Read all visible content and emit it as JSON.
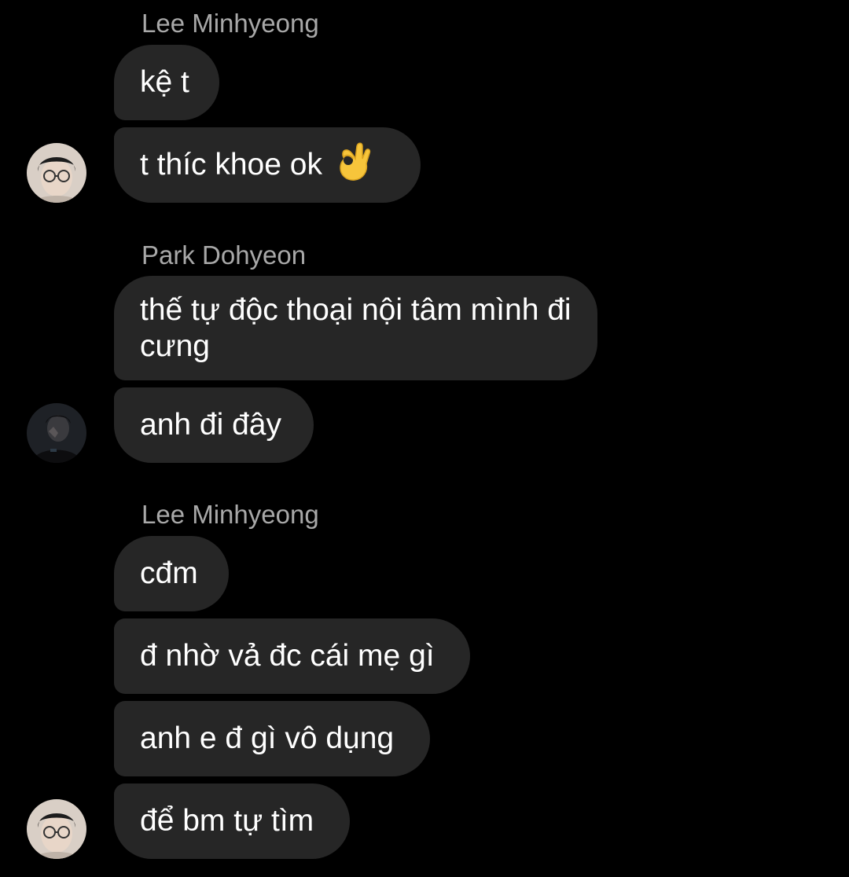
{
  "conversation": {
    "groups": [
      {
        "sender": "Lee Minhyeong",
        "avatar_icon": "profile-avatar-lee-minhyeong",
        "messages": [
          {
            "text": "kệ t"
          },
          {
            "text": "t thíc khoe ok",
            "emoji": "ok-hand-emoji"
          }
        ]
      },
      {
        "sender": "Park Dohyeon",
        "avatar_icon": "profile-avatar-park-dohyeon",
        "messages": [
          {
            "text": "thế tự độc thoại nội tâm mình đi cưng"
          },
          {
            "text": "anh đi đây"
          }
        ]
      },
      {
        "sender": "Lee Minhyeong",
        "avatar_icon": "profile-avatar-lee-minhyeong",
        "messages": [
          {
            "text": "cđm"
          },
          {
            "text": "đ nhờ vả đc cái mẹ gì"
          },
          {
            "text": "anh e đ gì vô dụng"
          },
          {
            "text": "để bm tự tìm"
          }
        ]
      }
    ]
  },
  "colors": {
    "background": "#000000",
    "bubble": "#262626",
    "message_text": "#ffffff",
    "sender_text": "#a8a8a8"
  }
}
